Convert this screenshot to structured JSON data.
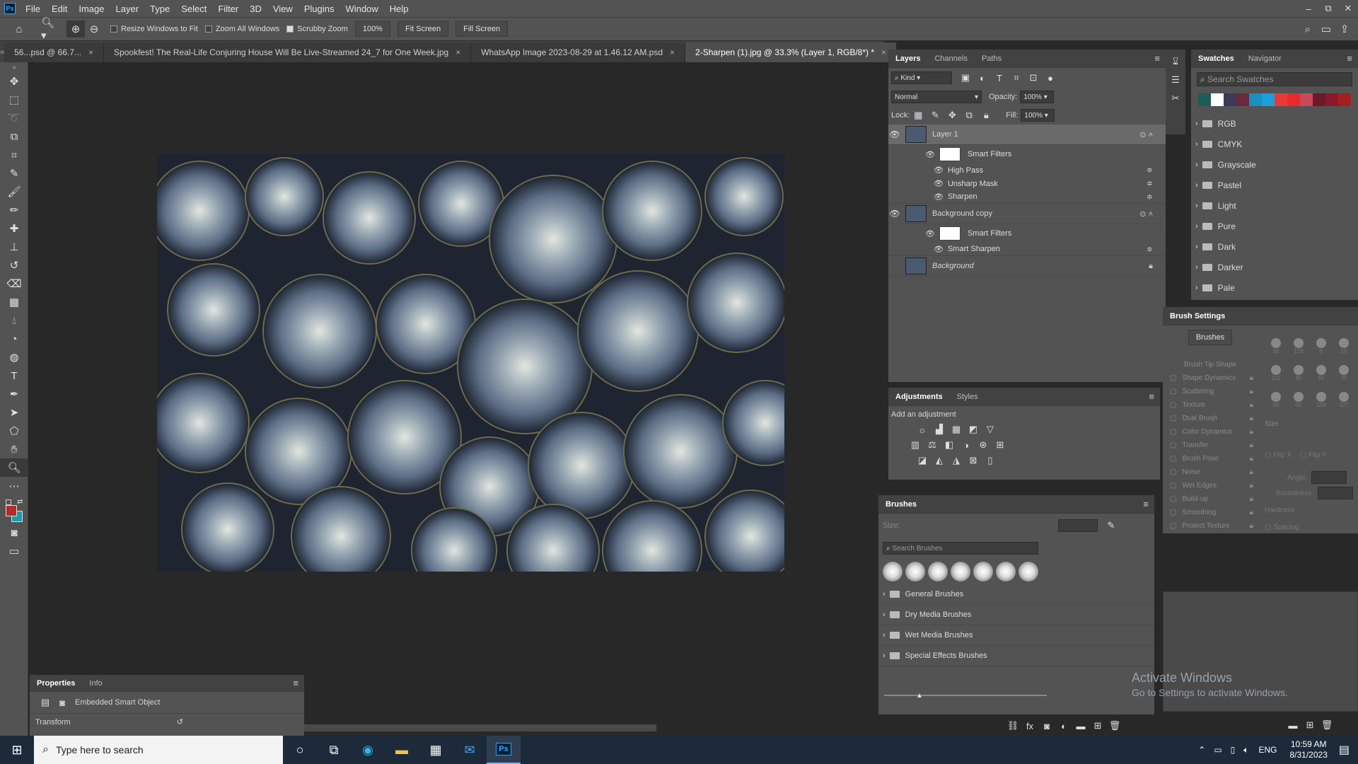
{
  "app": {
    "logo": "Ps"
  },
  "menu": [
    "File",
    "Edit",
    "Image",
    "Layer",
    "Type",
    "Select",
    "Filter",
    "3D",
    "View",
    "Plugins",
    "Window",
    "Help"
  ],
  "window_controls": {
    "minimize": "–",
    "restore": "⧉",
    "close": "✕"
  },
  "options_bar": {
    "resize_windows": "Resize Windows to Fit",
    "zoom_all": "Zoom All Windows",
    "scrubby_zoom": "Scrubby Zoom",
    "zoom_value": "100%",
    "fit_screen": "Fit Screen",
    "fill_screen": "Fill Screen"
  },
  "doc_tabs": [
    {
      "label": "56...psd @ 66.7..."
    },
    {
      "label": "Spookfest! The Real-Life Conjuring House Will Be Live-Streamed 24_7 for One Week.jpg"
    },
    {
      "label": "WhatsApp Image 2023-08-29 at 1.46.12 AM.psd"
    },
    {
      "label": "2-Sharpen (1).jpg @ 33.3% (Layer 1, RGB/8*) *"
    }
  ],
  "layers_panel": {
    "tabs": [
      "Layers",
      "Channels",
      "Paths"
    ],
    "filter_kind": "Kind",
    "blend_mode": "Normal",
    "opacity_label": "Opacity:",
    "opacity": "100%",
    "lock_label": "Lock:",
    "fill_label": "Fill:",
    "fill": "100%",
    "layers": [
      {
        "name": "Layer 1",
        "smart_filters": "Smart Filters",
        "filters": [
          "High Pass",
          "Unsharp Mask",
          "Sharpen"
        ]
      },
      {
        "name": "Background copy",
        "smart_filters": "Smart Filters",
        "filters": [
          "Smart Sharpen"
        ]
      },
      {
        "name": "Background"
      }
    ]
  },
  "swatches_panel": {
    "tabs": [
      "Swatches",
      "Navigator"
    ],
    "search_placeholder": "Search Swatches",
    "colors": [
      "#1d5c58",
      "#ffffff",
      "#3a3a5a",
      "#6a2a3a",
      "#1a8fc0",
      "#1c9fd8",
      "#e83a3a",
      "#e82a2a",
      "#c84a5a",
      "#6a1a2a",
      "#8a1a2a",
      "#a02020"
    ],
    "groups": [
      "RGB",
      "CMYK",
      "Grayscale",
      "Pastel",
      "Light",
      "Pure",
      "Dark",
      "Darker",
      "Pale"
    ]
  },
  "adjustments_panel": {
    "tabs": [
      "Adjustments",
      "Styles"
    ],
    "add_label": "Add an adjustment"
  },
  "brushes_panel": {
    "title": "Brushes",
    "size_label": "Size:",
    "search_placeholder": "Search Brushes",
    "groups": [
      "General Brushes",
      "Dry Media Brushes",
      "Wet Media Brushes",
      "Special Effects Brushes"
    ]
  },
  "brush_settings": {
    "title": "Brush Settings",
    "brushes_button": "Brushes",
    "tip_shape": "Brush Tip Shape",
    "options": [
      "Shape Dynamics",
      "Scattering",
      "Texture",
      "Dual Brush",
      "Color Dynamics",
      "Transfer",
      "Brush Pose",
      "Noise",
      "Wet Edges",
      "Build-up",
      "Smoothing",
      "Protect Texture"
    ],
    "size_label": "Size",
    "flip_x": "Flip X",
    "flip_y": "Flip Y",
    "angle": "Angle:",
    "roundness": "Roundness:",
    "hardness": "Hardness",
    "spacing": "Spacing",
    "tip_sizes": [
      "30",
      "123",
      "8",
      "10",
      "112",
      "60",
      "50",
      "25",
      "50",
      "60",
      "100",
      "127"
    ]
  },
  "properties_panel": {
    "tabs": [
      "Properties",
      "Info"
    ],
    "type": "Embedded Smart Object",
    "section": "Transform"
  },
  "watermark": {
    "line1": "Activate Windows",
    "line2": "Go to Settings to activate Windows."
  },
  "taskbar": {
    "search_placeholder": "Type here to search",
    "lang": "ENG",
    "time": "10:59 AM",
    "date": "8/31/2023"
  }
}
